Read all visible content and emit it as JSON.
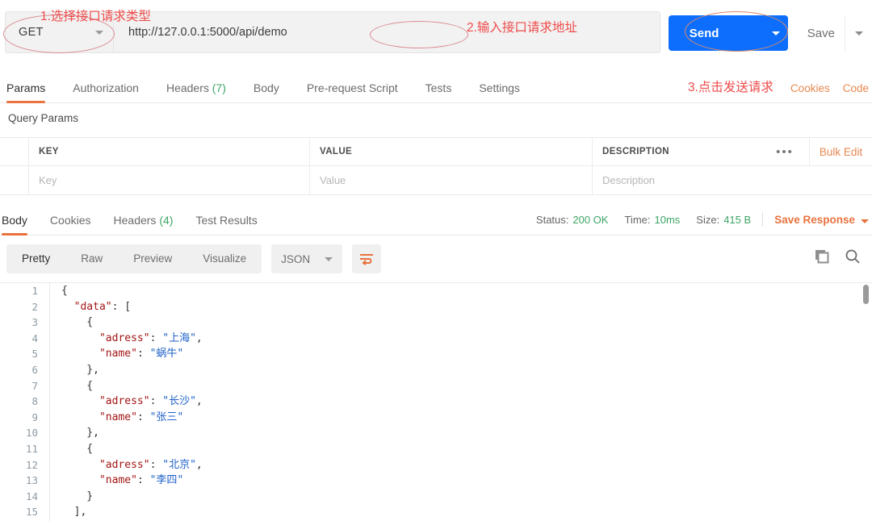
{
  "request": {
    "method": "GET",
    "url": "http://127.0.0.1:5000/api/demo",
    "send_label": "Send",
    "save_label": "Save"
  },
  "annotations": [
    {
      "id": "a1",
      "text": "1.选择接口请求类型"
    },
    {
      "id": "a2",
      "text": "2.输入接口请求地址"
    },
    {
      "id": "a3",
      "text": "3.点击发送请求"
    }
  ],
  "request_tabs": [
    {
      "label": "Params",
      "active": true
    },
    {
      "label": "Authorization",
      "active": false
    },
    {
      "label": "Headers",
      "count": "(7)",
      "active": false
    },
    {
      "label": "Body",
      "active": false
    },
    {
      "label": "Pre-request Script",
      "active": false
    },
    {
      "label": "Tests",
      "active": false
    },
    {
      "label": "Settings",
      "active": false
    }
  ],
  "request_links": [
    {
      "label": "Cookies"
    },
    {
      "label": "Code"
    }
  ],
  "query_params": {
    "title": "Query Params",
    "columns": [
      "KEY",
      "VALUE",
      "DESCRIPTION"
    ],
    "dots_label": "•••",
    "bulk_edit_label": "Bulk Edit",
    "placeholder_row": [
      "Key",
      "Value",
      "Description"
    ]
  },
  "response_tabs": [
    {
      "label": "Body",
      "active": true
    },
    {
      "label": "Cookies",
      "active": false
    },
    {
      "label": "Headers",
      "count": "(4)",
      "active": false
    },
    {
      "label": "Test Results",
      "active": false
    }
  ],
  "response_status": {
    "status_label": "Status:",
    "status_value": "200 OK",
    "time_label": "Time:",
    "time_value": "10ms",
    "size_label": "Size:",
    "size_value": "415 B",
    "save_response_label": "Save Response"
  },
  "format_bar": {
    "views": [
      {
        "label": "Pretty",
        "active": true
      },
      {
        "label": "Raw",
        "active": false
      },
      {
        "label": "Preview",
        "active": false
      },
      {
        "label": "Visualize",
        "active": false
      }
    ],
    "language": "JSON"
  },
  "body": {
    "line_numbers": [
      1,
      2,
      3,
      4,
      5,
      6,
      7,
      8,
      9,
      10,
      11,
      12,
      13,
      14,
      15
    ],
    "lines": [
      [
        {
          "t": "{",
          "c": "punc"
        }
      ],
      [
        {
          "t": "  ",
          "c": "punc"
        },
        {
          "t": "\"data\"",
          "c": "key"
        },
        {
          "t": ": [",
          "c": "punc"
        }
      ],
      [
        {
          "t": "    {",
          "c": "punc"
        }
      ],
      [
        {
          "t": "      ",
          "c": "punc"
        },
        {
          "t": "\"adress\"",
          "c": "key"
        },
        {
          "t": ": ",
          "c": "punc"
        },
        {
          "t": "\"上海\"",
          "c": "str"
        },
        {
          "t": ",",
          "c": "punc"
        }
      ],
      [
        {
          "t": "      ",
          "c": "punc"
        },
        {
          "t": "\"name\"",
          "c": "key"
        },
        {
          "t": ": ",
          "c": "punc"
        },
        {
          "t": "\"蜗牛\"",
          "c": "str"
        }
      ],
      [
        {
          "t": "    },",
          "c": "punc"
        }
      ],
      [
        {
          "t": "    {",
          "c": "punc"
        }
      ],
      [
        {
          "t": "      ",
          "c": "punc"
        },
        {
          "t": "\"adress\"",
          "c": "key"
        },
        {
          "t": ": ",
          "c": "punc"
        },
        {
          "t": "\"长沙\"",
          "c": "str"
        },
        {
          "t": ",",
          "c": "punc"
        }
      ],
      [
        {
          "t": "      ",
          "c": "punc"
        },
        {
          "t": "\"name\"",
          "c": "key"
        },
        {
          "t": ": ",
          "c": "punc"
        },
        {
          "t": "\"张三\"",
          "c": "str"
        }
      ],
      [
        {
          "t": "    },",
          "c": "punc"
        }
      ],
      [
        {
          "t": "    {",
          "c": "punc"
        }
      ],
      [
        {
          "t": "      ",
          "c": "punc"
        },
        {
          "t": "\"adress\"",
          "c": "key"
        },
        {
          "t": ": ",
          "c": "punc"
        },
        {
          "t": "\"北京\"",
          "c": "str"
        },
        {
          "t": ",",
          "c": "punc"
        }
      ],
      [
        {
          "t": "      ",
          "c": "punc"
        },
        {
          "t": "\"name\"",
          "c": "key"
        },
        {
          "t": ": ",
          "c": "punc"
        },
        {
          "t": "\"李四\"",
          "c": "str"
        }
      ],
      [
        {
          "t": "    }",
          "c": "punc"
        }
      ],
      [
        {
          "t": "  ],",
          "c": "punc"
        }
      ]
    ]
  },
  "colors": {
    "accent_orange": "#e8733f",
    "send_blue": "#0d6efd",
    "status_green": "#3ea566",
    "annotation_red": "#ef4b4b",
    "json_key": "#a31515",
    "json_string": "#1f62c9"
  }
}
